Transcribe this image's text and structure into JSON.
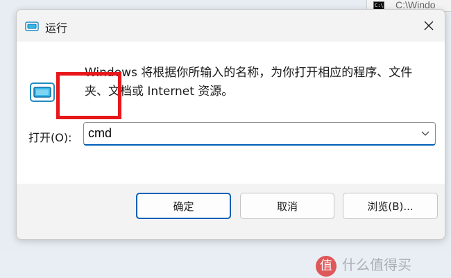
{
  "background_window": {
    "title": "C:\\Windo",
    "icon": "cmd-icon"
  },
  "dialog": {
    "title": "运行",
    "description": "Windows 将根据你所输入的名称，为你打开相应的程序、文件夹、文档或 Internet 资源。",
    "open_label": "打开(O):",
    "input_value": "cmd",
    "buttons": {
      "ok": "确定",
      "cancel": "取消",
      "browse": "浏览(B)..."
    }
  },
  "watermark": {
    "logo_text": "值",
    "text": "什么值得买"
  },
  "colors": {
    "accent": "#005fb8",
    "highlight": "#e8171a"
  }
}
